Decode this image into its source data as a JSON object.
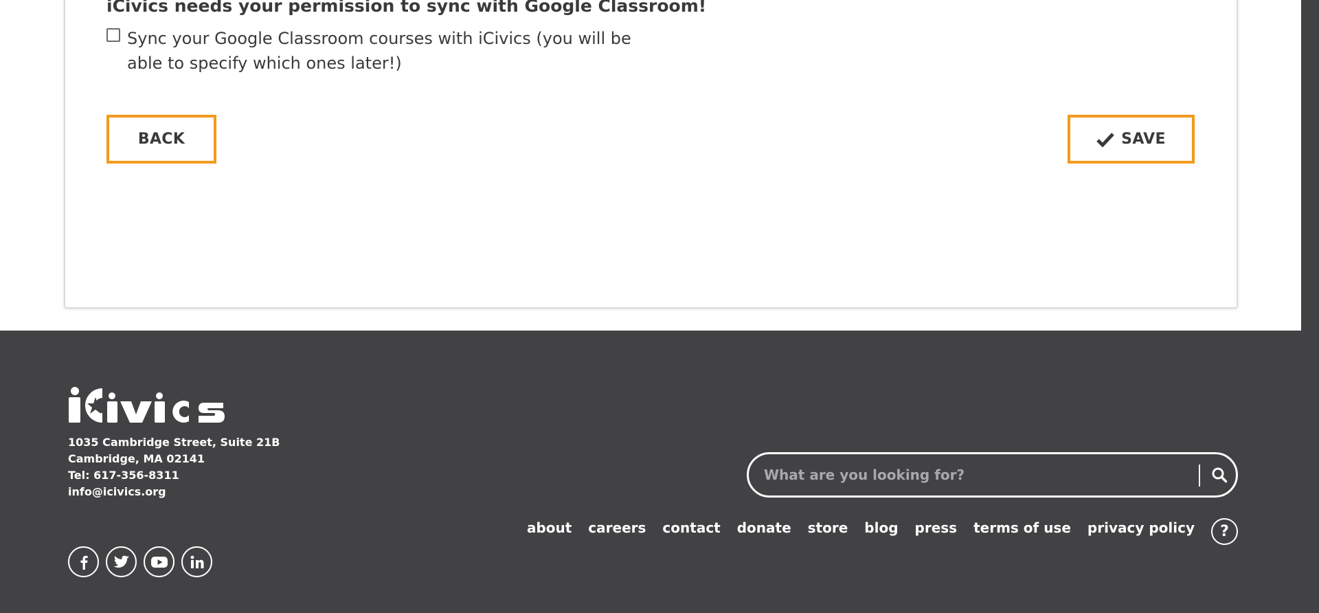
{
  "form": {
    "permission_heading": "iCivics needs your permission to sync with Google Classroom!",
    "sync_checkbox_checked": false,
    "sync_label": "Sync your Google Classroom courses with iCivics (you will be able to specify which ones later!)",
    "back_label": "BACK",
    "save_label": "SAVE",
    "save_icon": "check-icon"
  },
  "footer": {
    "logo_text": "iCivics",
    "address_lines": [
      "1035 Cambridge Street, Suite 21B",
      "Cambridge, MA 02141",
      "Tel: 617-356-8311",
      "info@icivics.org"
    ],
    "socials": [
      "facebook-icon",
      "twitter-icon",
      "youtube-icon",
      "linkedin-icon"
    ],
    "search": {
      "placeholder": "What are you looking for?",
      "value": "",
      "icon": "search-icon"
    },
    "nav_links": [
      "about",
      "careers",
      "contact",
      "donate",
      "store",
      "blog",
      "press",
      "terms of use",
      "privacy policy"
    ],
    "help_label": "?"
  },
  "colors": {
    "accent": "#f39a1e",
    "footer_bg": "#424244",
    "text": "#3a3a3c"
  }
}
